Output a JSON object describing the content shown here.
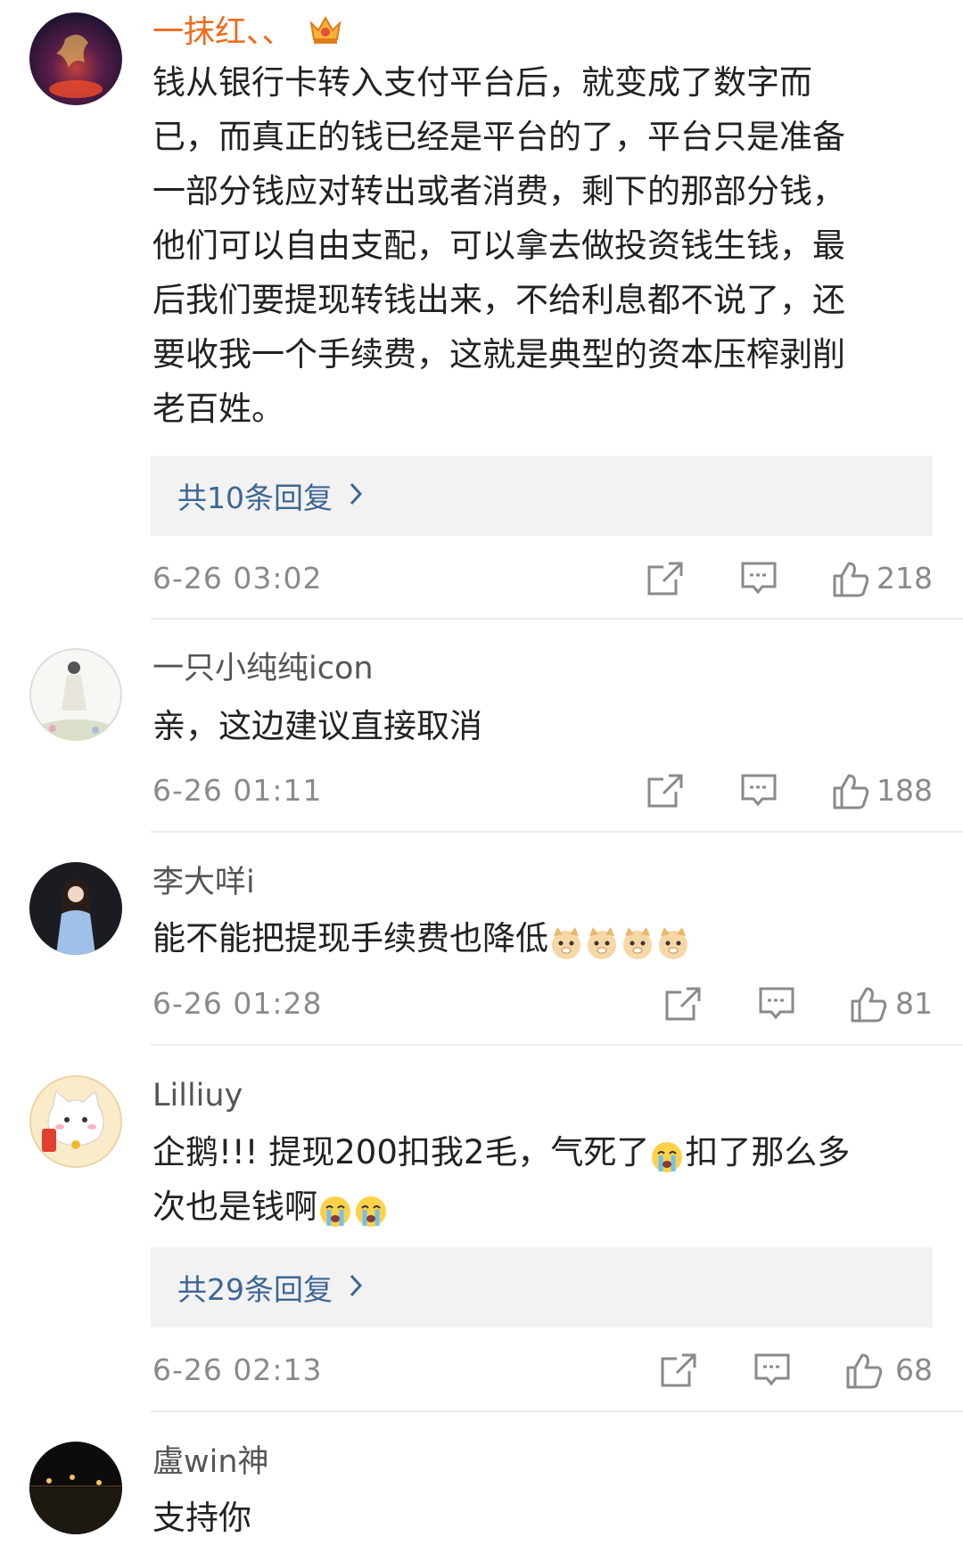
{
  "comments": [
    {
      "username": "一抹红、、",
      "text_lines": [
        "钱从银行卡转入支付平台后，就变成了数字而",
        "已，而真正的钱已经是平台的了，平台只是准备",
        "一部分钱应对转出或者消费，剩下的那部分钱，",
        "他们可以自由支配，可以拿去做投资钱生钱，最",
        "后我们要提现转钱出来，不给利息都不说了，还",
        "要收我一个手续费，这就是典型的资本压榨剥削",
        "老百姓。"
      ],
      "replies": "共10条回复",
      "time": "6-26 03:02",
      "likes": "218"
    },
    {
      "username": "一只小纯纯icon",
      "text": "亲，这边建议直接取消",
      "time": "6-26 01:11",
      "likes": "188"
    },
    {
      "username": "李大咩i",
      "text": "能不能把提现手续费也降低",
      "time": "6-26 01:28",
      "likes": "81"
    },
    {
      "username": "Lilliuy",
      "text_line1_part1": "企鹅!!! 提现200扣我2毛，气死了",
      "text_line1_part2": "扣了那么多",
      "text_line2": "次也是钱啊",
      "replies": "共29条回复",
      "time": "6-26 02:13",
      "likes": "68"
    },
    {
      "username": "盧win神",
      "text": "支持你"
    }
  ],
  "icons": {
    "share": "share-icon",
    "comment": "comment-icon",
    "like": "like-icon",
    "crown": "crown-icon",
    "doge": "doge-emoji",
    "cry": "crying-emoji"
  },
  "colors": {
    "vip_name": "#f06a1a",
    "reply_link": "#3d6694",
    "meta_gray": "#8a8a8a"
  }
}
